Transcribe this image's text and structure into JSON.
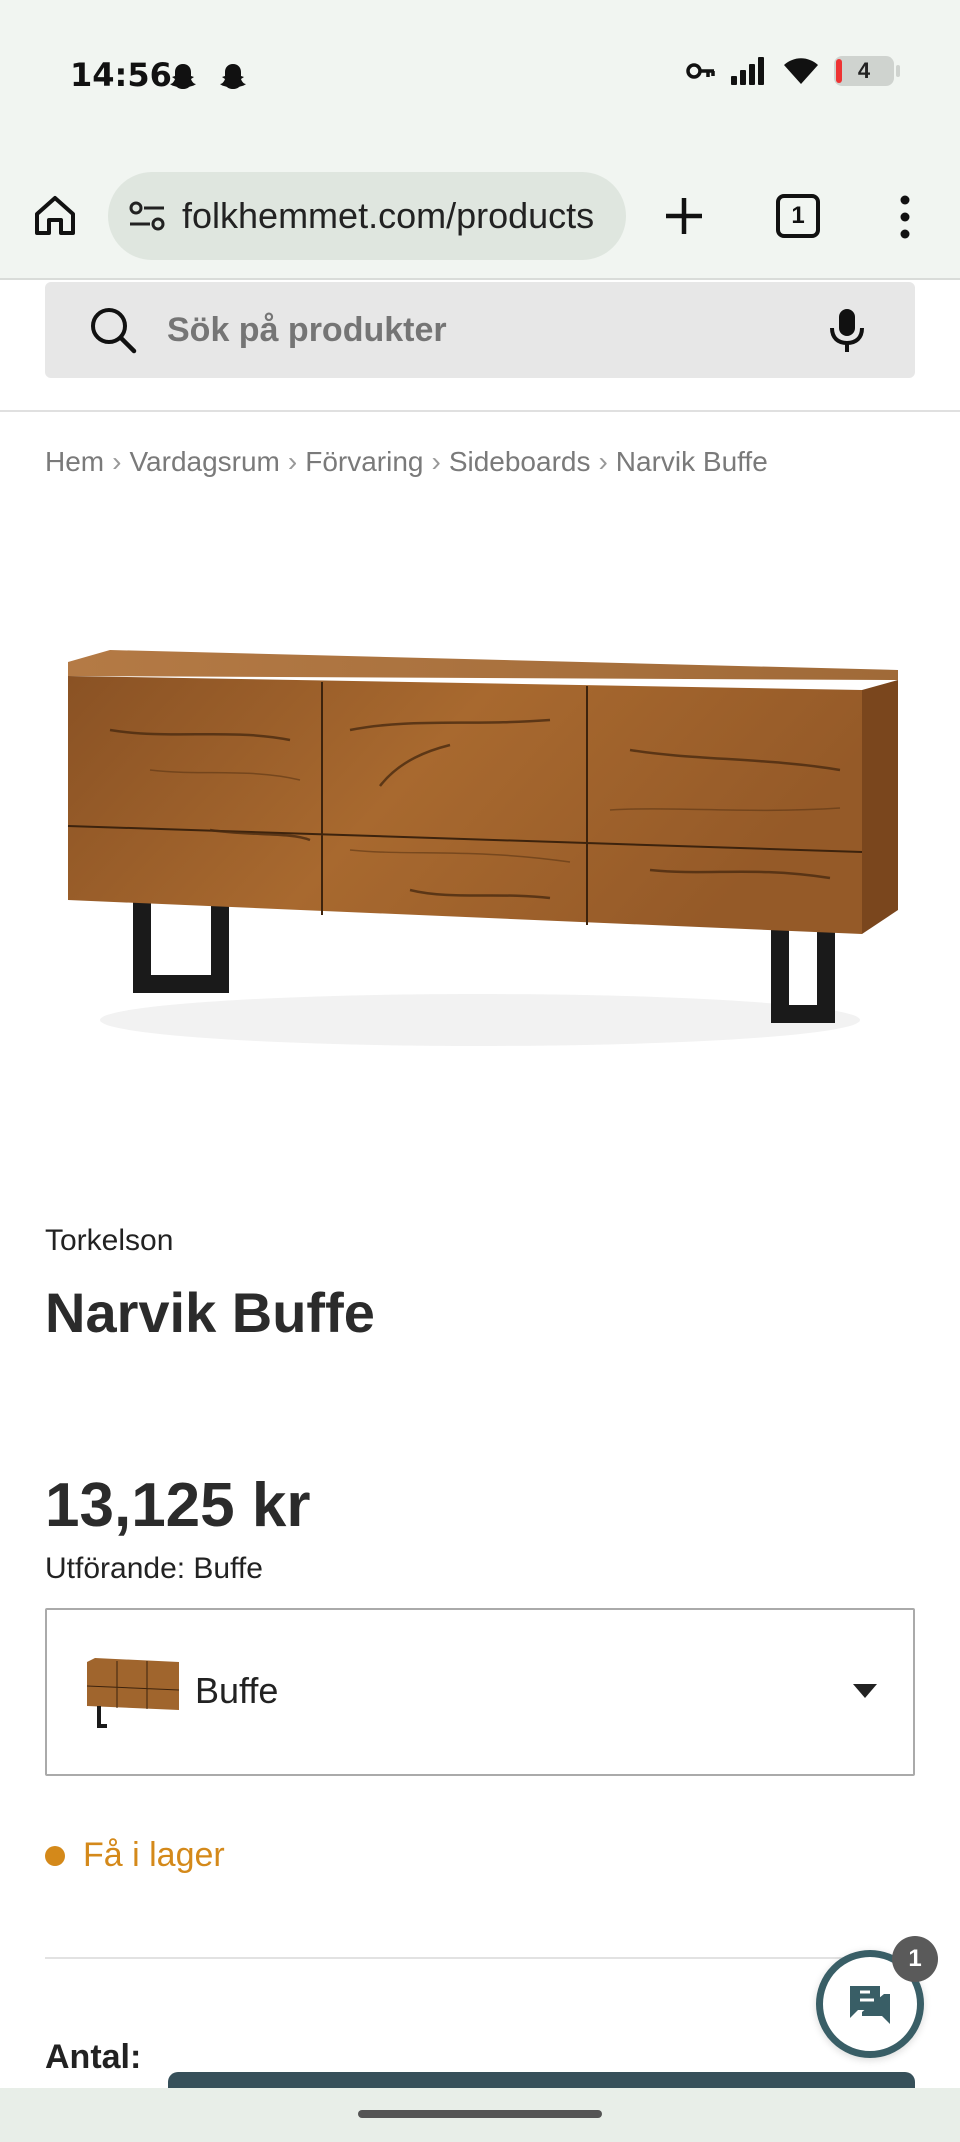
{
  "status_bar": {
    "time": "14:56",
    "battery_level": "4"
  },
  "browser": {
    "url": "folkhemmet.com/products",
    "tab_count": "1"
  },
  "search": {
    "placeholder": "Sök på produkter"
  },
  "breadcrumb": [
    "Hem",
    "Vardagsrum",
    "Förvaring",
    "Sideboards",
    "Narvik Buffe"
  ],
  "breadcrumb_separator": "›",
  "product": {
    "brand": "Torkelson",
    "title": "Narvik Buffe",
    "price": "13,125 kr",
    "variant_label": "Utförande: Buffe",
    "variant_value": "Buffe",
    "stock_status": "Få i lager",
    "quantity_label": "Antal:"
  },
  "chat": {
    "badge_count": "1"
  },
  "colors": {
    "stock_accent": "#d4891a",
    "chat_accent": "#395e66",
    "cta": "#37505a"
  }
}
